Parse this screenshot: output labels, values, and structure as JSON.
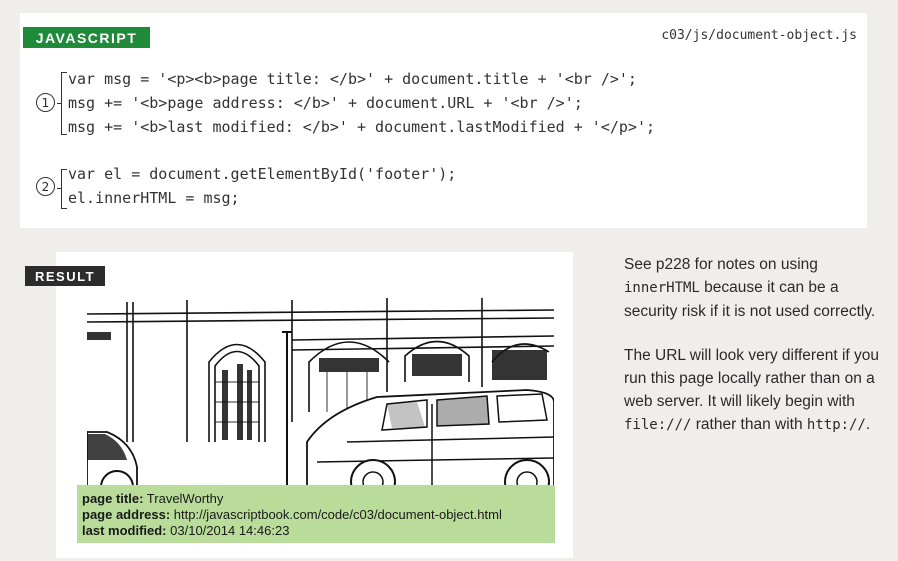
{
  "code_panel": {
    "label": "JAVASCRIPT",
    "filename": "c03/js/document-object.js",
    "callout_1": "1",
    "callout_2": "2",
    "lines": [
      "var msg = '<p><b>page title: </b>' + document.title + '<br />';",
      "msg += '<b>page address: </b>' + document.URL + '<br />';",
      "msg += '<b>last modified: </b>' + document.lastModified + '</p>';",
      "var el = document.getElementById('footer');",
      "el.innerHTML = msg;"
    ]
  },
  "result_panel": {
    "label": "RESULT",
    "footer": {
      "title_label": "page title:",
      "title_value": "TravelWorthy",
      "address_label": "page address:",
      "address_value": "http://javascriptbook.com/code/c03/document-object.html",
      "modified_label": "last modified:",
      "modified_value": "03/10/2014 14:46:23"
    }
  },
  "notes": {
    "p1_a": "See p228 for notes on using",
    "p1_code": "innerHTML",
    "p1_b": "because it can be a security risk if it is not used correctly.",
    "p2_a": "The URL will look very different if you run this page locally rather than on a web server. It will likely begin with",
    "p2_code1": "file:///",
    "p2_b": "rather than with",
    "p2_code2": "http://",
    "p2_c": "."
  }
}
